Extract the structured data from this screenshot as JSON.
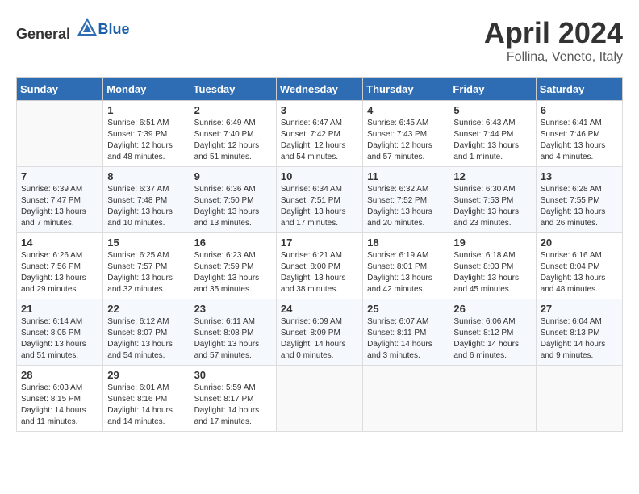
{
  "header": {
    "logo_general": "General",
    "logo_blue": "Blue",
    "title": "April 2024",
    "subtitle": "Follina, Veneto, Italy"
  },
  "calendar": {
    "columns": [
      "Sunday",
      "Monday",
      "Tuesday",
      "Wednesday",
      "Thursday",
      "Friday",
      "Saturday"
    ],
    "weeks": [
      [
        {
          "day": "",
          "sunrise": "",
          "sunset": "",
          "daylight": "",
          "empty": true
        },
        {
          "day": "1",
          "sunrise": "Sunrise: 6:51 AM",
          "sunset": "Sunset: 7:39 PM",
          "daylight": "Daylight: 12 hours and 48 minutes.",
          "empty": false
        },
        {
          "day": "2",
          "sunrise": "Sunrise: 6:49 AM",
          "sunset": "Sunset: 7:40 PM",
          "daylight": "Daylight: 12 hours and 51 minutes.",
          "empty": false
        },
        {
          "day": "3",
          "sunrise": "Sunrise: 6:47 AM",
          "sunset": "Sunset: 7:42 PM",
          "daylight": "Daylight: 12 hours and 54 minutes.",
          "empty": false
        },
        {
          "day": "4",
          "sunrise": "Sunrise: 6:45 AM",
          "sunset": "Sunset: 7:43 PM",
          "daylight": "Daylight: 12 hours and 57 minutes.",
          "empty": false
        },
        {
          "day": "5",
          "sunrise": "Sunrise: 6:43 AM",
          "sunset": "Sunset: 7:44 PM",
          "daylight": "Daylight: 13 hours and 1 minute.",
          "empty": false
        },
        {
          "day": "6",
          "sunrise": "Sunrise: 6:41 AM",
          "sunset": "Sunset: 7:46 PM",
          "daylight": "Daylight: 13 hours and 4 minutes.",
          "empty": false
        }
      ],
      [
        {
          "day": "7",
          "sunrise": "Sunrise: 6:39 AM",
          "sunset": "Sunset: 7:47 PM",
          "daylight": "Daylight: 13 hours and 7 minutes.",
          "empty": false
        },
        {
          "day": "8",
          "sunrise": "Sunrise: 6:37 AM",
          "sunset": "Sunset: 7:48 PM",
          "daylight": "Daylight: 13 hours and 10 minutes.",
          "empty": false
        },
        {
          "day": "9",
          "sunrise": "Sunrise: 6:36 AM",
          "sunset": "Sunset: 7:50 PM",
          "daylight": "Daylight: 13 hours and 13 minutes.",
          "empty": false
        },
        {
          "day": "10",
          "sunrise": "Sunrise: 6:34 AM",
          "sunset": "Sunset: 7:51 PM",
          "daylight": "Daylight: 13 hours and 17 minutes.",
          "empty": false
        },
        {
          "day": "11",
          "sunrise": "Sunrise: 6:32 AM",
          "sunset": "Sunset: 7:52 PM",
          "daylight": "Daylight: 13 hours and 20 minutes.",
          "empty": false
        },
        {
          "day": "12",
          "sunrise": "Sunrise: 6:30 AM",
          "sunset": "Sunset: 7:53 PM",
          "daylight": "Daylight: 13 hours and 23 minutes.",
          "empty": false
        },
        {
          "day": "13",
          "sunrise": "Sunrise: 6:28 AM",
          "sunset": "Sunset: 7:55 PM",
          "daylight": "Daylight: 13 hours and 26 minutes.",
          "empty": false
        }
      ],
      [
        {
          "day": "14",
          "sunrise": "Sunrise: 6:26 AM",
          "sunset": "Sunset: 7:56 PM",
          "daylight": "Daylight: 13 hours and 29 minutes.",
          "empty": false
        },
        {
          "day": "15",
          "sunrise": "Sunrise: 6:25 AM",
          "sunset": "Sunset: 7:57 PM",
          "daylight": "Daylight: 13 hours and 32 minutes.",
          "empty": false
        },
        {
          "day": "16",
          "sunrise": "Sunrise: 6:23 AM",
          "sunset": "Sunset: 7:59 PM",
          "daylight": "Daylight: 13 hours and 35 minutes.",
          "empty": false
        },
        {
          "day": "17",
          "sunrise": "Sunrise: 6:21 AM",
          "sunset": "Sunset: 8:00 PM",
          "daylight": "Daylight: 13 hours and 38 minutes.",
          "empty": false
        },
        {
          "day": "18",
          "sunrise": "Sunrise: 6:19 AM",
          "sunset": "Sunset: 8:01 PM",
          "daylight": "Daylight: 13 hours and 42 minutes.",
          "empty": false
        },
        {
          "day": "19",
          "sunrise": "Sunrise: 6:18 AM",
          "sunset": "Sunset: 8:03 PM",
          "daylight": "Daylight: 13 hours and 45 minutes.",
          "empty": false
        },
        {
          "day": "20",
          "sunrise": "Sunrise: 6:16 AM",
          "sunset": "Sunset: 8:04 PM",
          "daylight": "Daylight: 13 hours and 48 minutes.",
          "empty": false
        }
      ],
      [
        {
          "day": "21",
          "sunrise": "Sunrise: 6:14 AM",
          "sunset": "Sunset: 8:05 PM",
          "daylight": "Daylight: 13 hours and 51 minutes.",
          "empty": false
        },
        {
          "day": "22",
          "sunrise": "Sunrise: 6:12 AM",
          "sunset": "Sunset: 8:07 PM",
          "daylight": "Daylight: 13 hours and 54 minutes.",
          "empty": false
        },
        {
          "day": "23",
          "sunrise": "Sunrise: 6:11 AM",
          "sunset": "Sunset: 8:08 PM",
          "daylight": "Daylight: 13 hours and 57 minutes.",
          "empty": false
        },
        {
          "day": "24",
          "sunrise": "Sunrise: 6:09 AM",
          "sunset": "Sunset: 8:09 PM",
          "daylight": "Daylight: 14 hours and 0 minutes.",
          "empty": false
        },
        {
          "day": "25",
          "sunrise": "Sunrise: 6:07 AM",
          "sunset": "Sunset: 8:11 PM",
          "daylight": "Daylight: 14 hours and 3 minutes.",
          "empty": false
        },
        {
          "day": "26",
          "sunrise": "Sunrise: 6:06 AM",
          "sunset": "Sunset: 8:12 PM",
          "daylight": "Daylight: 14 hours and 6 minutes.",
          "empty": false
        },
        {
          "day": "27",
          "sunrise": "Sunrise: 6:04 AM",
          "sunset": "Sunset: 8:13 PM",
          "daylight": "Daylight: 14 hours and 9 minutes.",
          "empty": false
        }
      ],
      [
        {
          "day": "28",
          "sunrise": "Sunrise: 6:03 AM",
          "sunset": "Sunset: 8:15 PM",
          "daylight": "Daylight: 14 hours and 11 minutes.",
          "empty": false
        },
        {
          "day": "29",
          "sunrise": "Sunrise: 6:01 AM",
          "sunset": "Sunset: 8:16 PM",
          "daylight": "Daylight: 14 hours and 14 minutes.",
          "empty": false
        },
        {
          "day": "30",
          "sunrise": "Sunrise: 5:59 AM",
          "sunset": "Sunset: 8:17 PM",
          "daylight": "Daylight: 14 hours and 17 minutes.",
          "empty": false
        },
        {
          "day": "",
          "sunrise": "",
          "sunset": "",
          "daylight": "",
          "empty": true
        },
        {
          "day": "",
          "sunrise": "",
          "sunset": "",
          "daylight": "",
          "empty": true
        },
        {
          "day": "",
          "sunrise": "",
          "sunset": "",
          "daylight": "",
          "empty": true
        },
        {
          "day": "",
          "sunrise": "",
          "sunset": "",
          "daylight": "",
          "empty": true
        }
      ]
    ]
  }
}
